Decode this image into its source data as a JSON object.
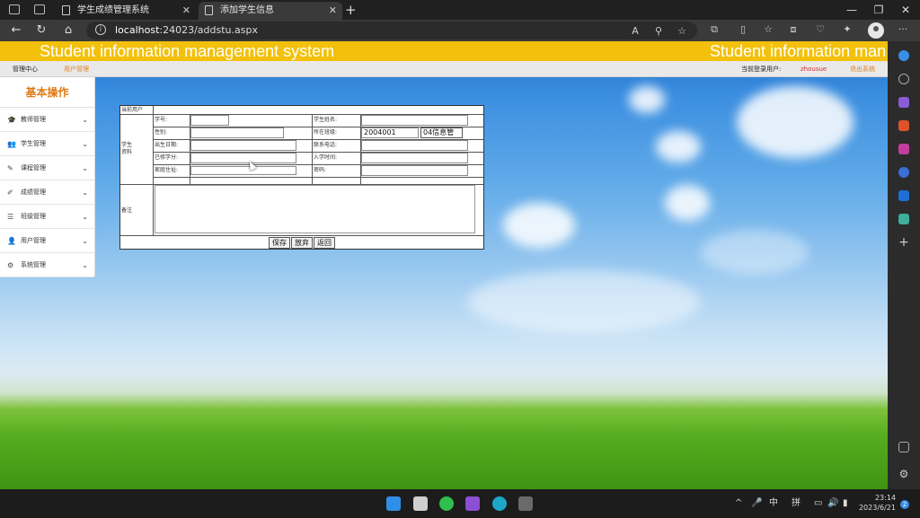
{
  "browser": {
    "tabs": [
      {
        "title": "学生成绩管理系统",
        "active": false
      },
      {
        "title": "添加学生信息",
        "active": true
      }
    ],
    "url_host": "localhost",
    "url_rest": ":24023/addstu.aspx"
  },
  "banner": {
    "title": "Student information management system",
    "title_repeat": "Student information man",
    "color": "#f3c10b"
  },
  "subnav": {
    "home": "管理中心",
    "current": "用户管理",
    "login_label": "当前登录用户:",
    "username": "zhousue",
    "logout": "退出系统"
  },
  "sidebar": {
    "title": "基本操作",
    "items": [
      {
        "label": "教师管理",
        "icon": "graduation-cap-icon"
      },
      {
        "label": "学生管理",
        "icon": "users-icon"
      },
      {
        "label": "课程管理",
        "icon": "edit-icon"
      },
      {
        "label": "成绩管理",
        "icon": "edit-square-icon"
      },
      {
        "label": "班级管理",
        "icon": "list-icon"
      },
      {
        "label": "用户管理",
        "icon": "user-icon"
      },
      {
        "label": "系统管理",
        "icon": "gear-icon"
      }
    ]
  },
  "form": {
    "current_user_label": "当前用户",
    "section_label": "学生资料",
    "remark_label": "备注",
    "fields": {
      "student_id": {
        "label": "学号:",
        "value": ""
      },
      "student_name": {
        "label": "学生姓名:",
        "value": ""
      },
      "gender": {
        "label": "性别:",
        "value": ""
      },
      "class": {
        "label": "所在班级:",
        "value": "2004001",
        "select": "04信息管"
      },
      "birth_date": {
        "label": "出生日期:",
        "value": ""
      },
      "phone": {
        "label": "联系电话:",
        "value": ""
      },
      "credits": {
        "label": "已修学分:",
        "value": ""
      },
      "enroll_date": {
        "label": "入学时间:",
        "value": ""
      },
      "address": {
        "label": "家庭住址:",
        "value": ""
      },
      "password": {
        "label": "密码:",
        "value": ""
      }
    },
    "buttons": {
      "save": "保存",
      "cancel": "放弃",
      "back": "返回"
    }
  },
  "taskbar": {
    "ime_lang": "中",
    "ime_mode": "拼",
    "time": "23:14",
    "date": "2023/6/21",
    "notifications": "2"
  }
}
